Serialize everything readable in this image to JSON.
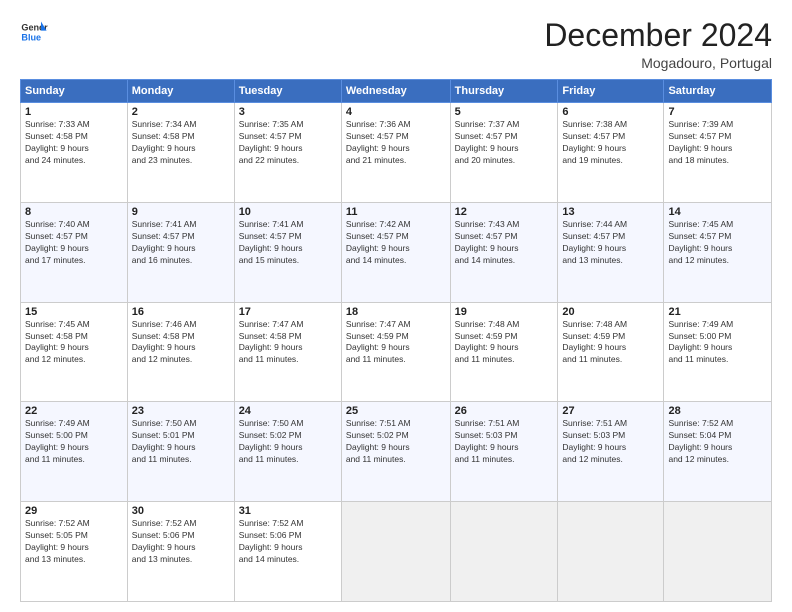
{
  "logo": {
    "line1": "General",
    "line2": "Blue"
  },
  "header": {
    "title": "December 2024",
    "subtitle": "Mogadouro, Portugal"
  },
  "weekdays": [
    "Sunday",
    "Monday",
    "Tuesday",
    "Wednesday",
    "Thursday",
    "Friday",
    "Saturday"
  ],
  "weeks": [
    [
      {
        "day": "1",
        "info": "Sunrise: 7:33 AM\nSunset: 4:58 PM\nDaylight: 9 hours\nand 24 minutes."
      },
      {
        "day": "2",
        "info": "Sunrise: 7:34 AM\nSunset: 4:58 PM\nDaylight: 9 hours\nand 23 minutes."
      },
      {
        "day": "3",
        "info": "Sunrise: 7:35 AM\nSunset: 4:57 PM\nDaylight: 9 hours\nand 22 minutes."
      },
      {
        "day": "4",
        "info": "Sunrise: 7:36 AM\nSunset: 4:57 PM\nDaylight: 9 hours\nand 21 minutes."
      },
      {
        "day": "5",
        "info": "Sunrise: 7:37 AM\nSunset: 4:57 PM\nDaylight: 9 hours\nand 20 minutes."
      },
      {
        "day": "6",
        "info": "Sunrise: 7:38 AM\nSunset: 4:57 PM\nDaylight: 9 hours\nand 19 minutes."
      },
      {
        "day": "7",
        "info": "Sunrise: 7:39 AM\nSunset: 4:57 PM\nDaylight: 9 hours\nand 18 minutes."
      }
    ],
    [
      {
        "day": "8",
        "info": "Sunrise: 7:40 AM\nSunset: 4:57 PM\nDaylight: 9 hours\nand 17 minutes."
      },
      {
        "day": "9",
        "info": "Sunrise: 7:41 AM\nSunset: 4:57 PM\nDaylight: 9 hours\nand 16 minutes."
      },
      {
        "day": "10",
        "info": "Sunrise: 7:41 AM\nSunset: 4:57 PM\nDaylight: 9 hours\nand 15 minutes."
      },
      {
        "day": "11",
        "info": "Sunrise: 7:42 AM\nSunset: 4:57 PM\nDaylight: 9 hours\nand 14 minutes."
      },
      {
        "day": "12",
        "info": "Sunrise: 7:43 AM\nSunset: 4:57 PM\nDaylight: 9 hours\nand 14 minutes."
      },
      {
        "day": "13",
        "info": "Sunrise: 7:44 AM\nSunset: 4:57 PM\nDaylight: 9 hours\nand 13 minutes."
      },
      {
        "day": "14",
        "info": "Sunrise: 7:45 AM\nSunset: 4:57 PM\nDaylight: 9 hours\nand 12 minutes."
      }
    ],
    [
      {
        "day": "15",
        "info": "Sunrise: 7:45 AM\nSunset: 4:58 PM\nDaylight: 9 hours\nand 12 minutes."
      },
      {
        "day": "16",
        "info": "Sunrise: 7:46 AM\nSunset: 4:58 PM\nDaylight: 9 hours\nand 12 minutes."
      },
      {
        "day": "17",
        "info": "Sunrise: 7:47 AM\nSunset: 4:58 PM\nDaylight: 9 hours\nand 11 minutes."
      },
      {
        "day": "18",
        "info": "Sunrise: 7:47 AM\nSunset: 4:59 PM\nDaylight: 9 hours\nand 11 minutes."
      },
      {
        "day": "19",
        "info": "Sunrise: 7:48 AM\nSunset: 4:59 PM\nDaylight: 9 hours\nand 11 minutes."
      },
      {
        "day": "20",
        "info": "Sunrise: 7:48 AM\nSunset: 4:59 PM\nDaylight: 9 hours\nand 11 minutes."
      },
      {
        "day": "21",
        "info": "Sunrise: 7:49 AM\nSunset: 5:00 PM\nDaylight: 9 hours\nand 11 minutes."
      }
    ],
    [
      {
        "day": "22",
        "info": "Sunrise: 7:49 AM\nSunset: 5:00 PM\nDaylight: 9 hours\nand 11 minutes."
      },
      {
        "day": "23",
        "info": "Sunrise: 7:50 AM\nSunset: 5:01 PM\nDaylight: 9 hours\nand 11 minutes."
      },
      {
        "day": "24",
        "info": "Sunrise: 7:50 AM\nSunset: 5:02 PM\nDaylight: 9 hours\nand 11 minutes."
      },
      {
        "day": "25",
        "info": "Sunrise: 7:51 AM\nSunset: 5:02 PM\nDaylight: 9 hours\nand 11 minutes."
      },
      {
        "day": "26",
        "info": "Sunrise: 7:51 AM\nSunset: 5:03 PM\nDaylight: 9 hours\nand 11 minutes."
      },
      {
        "day": "27",
        "info": "Sunrise: 7:51 AM\nSunset: 5:03 PM\nDaylight: 9 hours\nand 12 minutes."
      },
      {
        "day": "28",
        "info": "Sunrise: 7:52 AM\nSunset: 5:04 PM\nDaylight: 9 hours\nand 12 minutes."
      }
    ],
    [
      {
        "day": "29",
        "info": "Sunrise: 7:52 AM\nSunset: 5:05 PM\nDaylight: 9 hours\nand 13 minutes."
      },
      {
        "day": "30",
        "info": "Sunrise: 7:52 AM\nSunset: 5:06 PM\nDaylight: 9 hours\nand 13 minutes."
      },
      {
        "day": "31",
        "info": "Sunrise: 7:52 AM\nSunset: 5:06 PM\nDaylight: 9 hours\nand 14 minutes."
      },
      null,
      null,
      null,
      null
    ]
  ]
}
